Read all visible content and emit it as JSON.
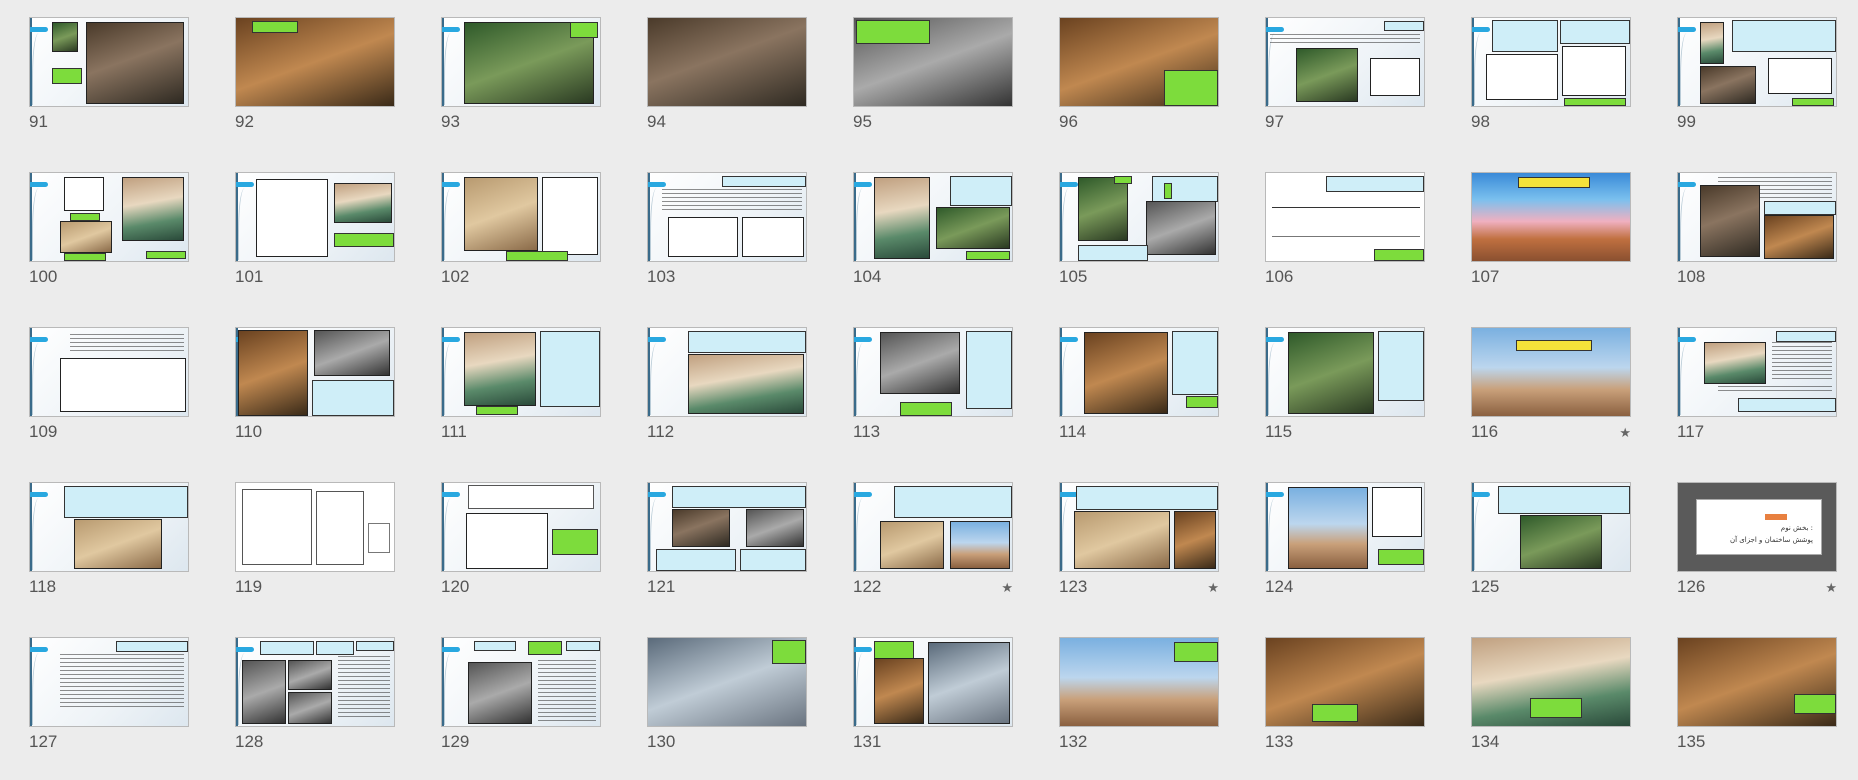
{
  "slides": [
    {
      "n": "91"
    },
    {
      "n": "92"
    },
    {
      "n": "93"
    },
    {
      "n": "94"
    },
    {
      "n": "95"
    },
    {
      "n": "96"
    },
    {
      "n": "97"
    },
    {
      "n": "98"
    },
    {
      "n": "99"
    },
    {
      "n": "100"
    },
    {
      "n": "101"
    },
    {
      "n": "102"
    },
    {
      "n": "103"
    },
    {
      "n": "104"
    },
    {
      "n": "105"
    },
    {
      "n": "106"
    },
    {
      "n": "107"
    },
    {
      "n": "108"
    },
    {
      "n": "109"
    },
    {
      "n": "110"
    },
    {
      "n": "111"
    },
    {
      "n": "112"
    },
    {
      "n": "113"
    },
    {
      "n": "114"
    },
    {
      "n": "115"
    },
    {
      "n": "116",
      "star": "★"
    },
    {
      "n": "117"
    },
    {
      "n": "118"
    },
    {
      "n": "119"
    },
    {
      "n": "120"
    },
    {
      "n": "121"
    },
    {
      "n": "122",
      "star": "★"
    },
    {
      "n": "123",
      "star": "★"
    },
    {
      "n": "124"
    },
    {
      "n": "125"
    },
    {
      "n": "126",
      "star": "★"
    },
    {
      "n": "127"
    },
    {
      "n": "128"
    },
    {
      "n": "129"
    },
    {
      "n": "130"
    },
    {
      "n": "131"
    },
    {
      "n": "132"
    },
    {
      "n": "133"
    },
    {
      "n": "134"
    },
    {
      "n": "135"
    }
  ],
  "slide_126": {
    "subtitle": "بخش نوم :",
    "title": "پوشش ساختمان و اجزای آن"
  },
  "colors": {
    "background": "#ececec",
    "accent_tab": "#29a8e0",
    "highlight_green": "#7ddc3c",
    "caption_cyan": "#cfeef8",
    "label_yellow": "#f4e23a"
  },
  "icons": {
    "star": "star-icon"
  }
}
